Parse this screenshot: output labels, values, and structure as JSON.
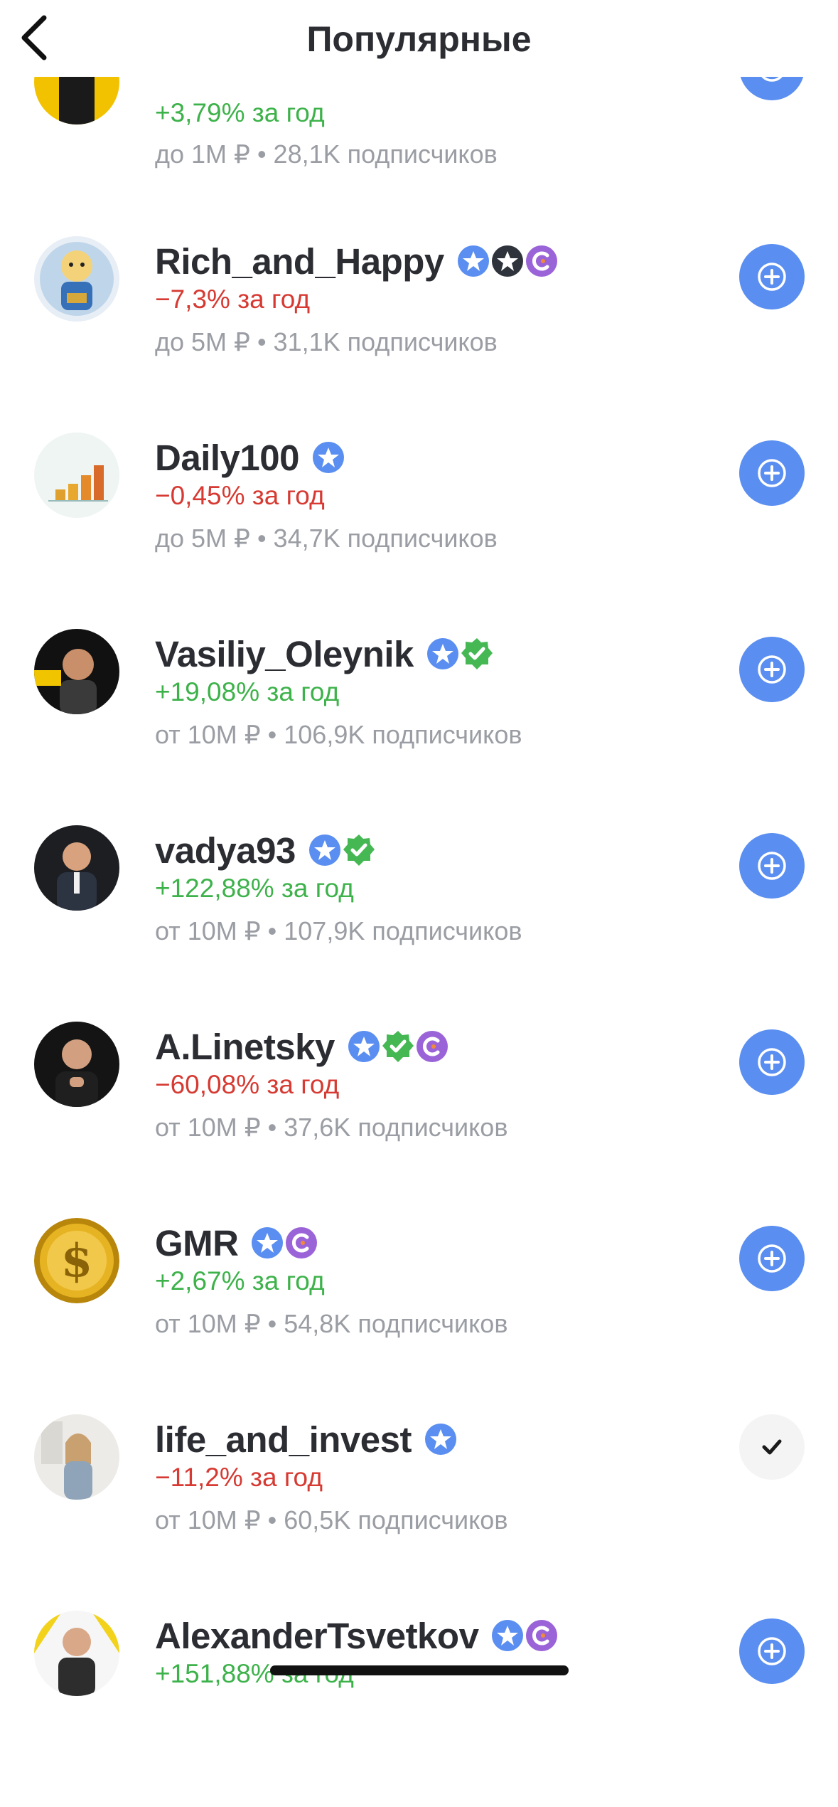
{
  "header": {
    "title": "Популярные"
  },
  "authors": [
    {
      "name": "",
      "change": "+3,79% за год",
      "direction": "positive",
      "meta": "до 1M ₽ • 28,1K подписчиков",
      "badges": [],
      "subscribed": false
    },
    {
      "name": "Rich_and_Happy",
      "change": "−7,3% за год",
      "direction": "negative",
      "meta": "до 5M ₽ • 31,1K подписчиков",
      "badges": [
        "star",
        "dark-star",
        "c"
      ],
      "subscribed": false
    },
    {
      "name": "Daily100",
      "change": "−0,45% за год",
      "direction": "negative",
      "meta": "до 5M ₽ • 34,7K подписчиков",
      "badges": [
        "star"
      ],
      "subscribed": false
    },
    {
      "name": "Vasiliy_Oleynik",
      "change": "+19,08% за год",
      "direction": "positive",
      "meta": "от 10M ₽ • 106,9K подписчиков",
      "badges": [
        "star",
        "verified"
      ],
      "subscribed": false
    },
    {
      "name": "vadya93",
      "change": "+122,88% за год",
      "direction": "positive",
      "meta": "от 10M ₽ • 107,9K подписчиков",
      "badges": [
        "star",
        "verified"
      ],
      "subscribed": false
    },
    {
      "name": "A.Linetsky",
      "change": "−60,08% за год",
      "direction": "negative",
      "meta": "от 10M ₽ • 37,6K подписчиков",
      "badges": [
        "star",
        "verified",
        "c"
      ],
      "subscribed": false
    },
    {
      "name": "GMR",
      "change": "+2,67% за год",
      "direction": "positive",
      "meta": "от 10M ₽ • 54,8K подписчиков",
      "badges": [
        "star",
        "c"
      ],
      "subscribed": false
    },
    {
      "name": "life_and_invest",
      "change": "−11,2% за год",
      "direction": "negative",
      "meta": "от 10M ₽ • 60,5K подписчиков",
      "badges": [
        "star"
      ],
      "subscribed": true
    },
    {
      "name": "AlexanderTsvetkov",
      "change": "+151,88% за год",
      "direction": "positive",
      "meta": "",
      "badges": [
        "star",
        "c"
      ],
      "subscribed": false
    }
  ],
  "icons": {
    "back": "chevron-left-icon",
    "add": "plus-circle-icon",
    "subscribed": "checkmark-icon",
    "star_badge": "star-badge-icon",
    "dark_star_badge": "dark-star-badge-icon",
    "verified_badge": "verified-badge-icon",
    "c_badge": "c-badge-icon"
  },
  "colors": {
    "positive": "#3db24a",
    "negative": "#d63a32",
    "accent": "#5a8ef0",
    "muted": "#9a9da3",
    "text": "#2b2d33"
  }
}
